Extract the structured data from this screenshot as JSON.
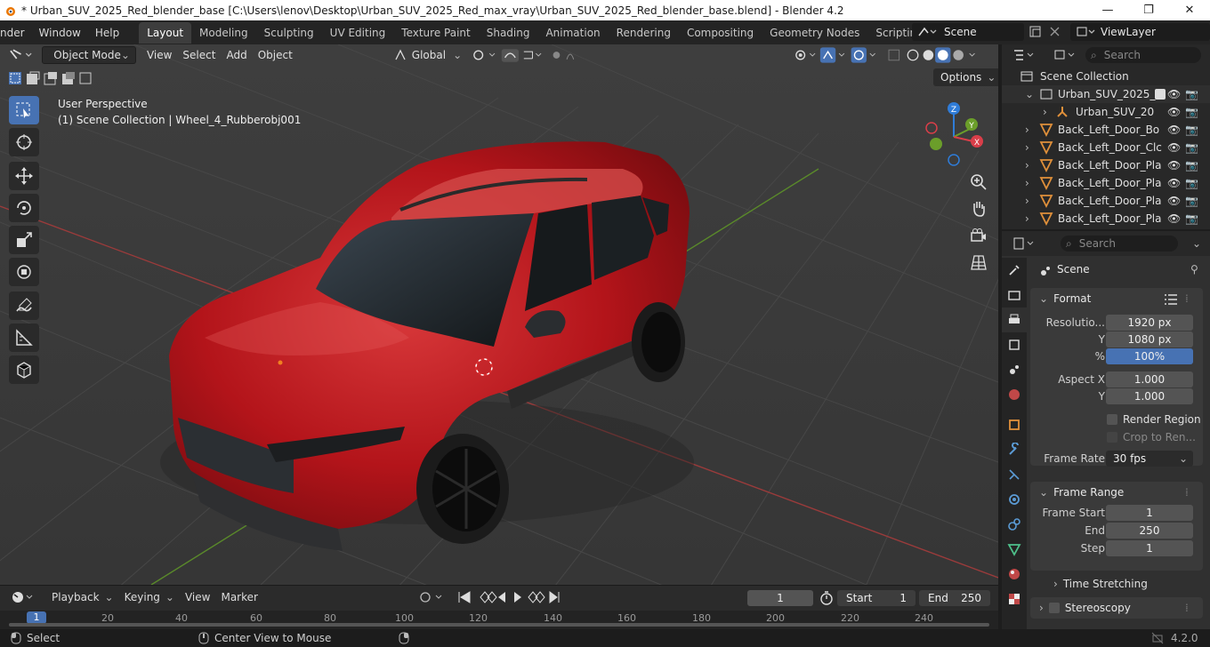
{
  "window": {
    "title": "* Urban_SUV_2025_Red_blender_base [C:\\Users\\lenov\\Desktop\\Urban_SUV_2025_Red_max_vray\\Urban_SUV_2025_Red_blender_base.blend] - Blender 4.2",
    "minimize": "—",
    "maximize": "❐",
    "close": "✕"
  },
  "menu": {
    "items": [
      "nder",
      "Window",
      "Help"
    ]
  },
  "workspaces": {
    "tabs": [
      "Layout",
      "Modeling",
      "Sculpting",
      "UV Editing",
      "Texture Paint",
      "Shading",
      "Animation",
      "Rendering",
      "Compositing",
      "Geometry Nodes",
      "Scripting"
    ],
    "active": "Layout",
    "add": "+"
  },
  "scene_selector": {
    "label": "Scene"
  },
  "viewlayer_selector": {
    "label": "ViewLayer"
  },
  "viewport": {
    "mode": "Object Mode",
    "menus": [
      "View",
      "Select",
      "Add",
      "Object"
    ],
    "transform_orientation": "Global",
    "info_line1": "User Perspective",
    "info_line2": "(1) Scene Collection | Wheel_4_Rubberobj001",
    "options": "Options",
    "gizmo_labels": {
      "z": "Z",
      "y": "Y",
      "x": "X"
    }
  },
  "timeline": {
    "menus": [
      "Playback",
      "Keying",
      "View",
      "Marker"
    ],
    "current_frame": "1",
    "start_label": "Start",
    "start_value": "1",
    "end_label": "End",
    "end_value": "250",
    "ruler_ticks": [
      "20",
      "40",
      "60",
      "80",
      "100",
      "120",
      "140",
      "160",
      "180",
      "200",
      "220",
      "240"
    ],
    "cursor_label": "1"
  },
  "statusbar": {
    "select": "Select",
    "center_view": "Center View to Mouse",
    "version": "4.2.0"
  },
  "outliner": {
    "search_placeholder": "Search",
    "root": "Scene Collection",
    "rows": [
      {
        "name": "Urban_SUV_2025_R",
        "type": "collection"
      },
      {
        "name": "Urban_SUV_20",
        "type": "armature"
      },
      {
        "name": "Back_Left_Door_Bo",
        "type": "mesh"
      },
      {
        "name": "Back_Left_Door_Clc",
        "type": "mesh"
      },
      {
        "name": "Back_Left_Door_Pla",
        "type": "mesh"
      },
      {
        "name": "Back_Left_Door_Pla",
        "type": "mesh"
      },
      {
        "name": "Back_Left_Door_Pla",
        "type": "mesh"
      },
      {
        "name": "Back_Left_Door_Pla",
        "type": "mesh"
      }
    ]
  },
  "properties": {
    "search_placeholder": "Search",
    "context": "Scene",
    "format": {
      "title": "Format",
      "resolution_x_label": "Resolutio...",
      "resolution_x": "1920 px",
      "resolution_y_label": "Y",
      "resolution_y": "1080 px",
      "percent_label": "%",
      "percent": "100%",
      "aspect_x_label": "Aspect X",
      "aspect_x": "1.000",
      "aspect_y_label": "Y",
      "aspect_y": "1.000",
      "render_region": "Render Region",
      "crop": "Crop to Ren...",
      "frame_rate_label": "Frame Rate",
      "frame_rate": "30 fps"
    },
    "frame_range": {
      "title": "Frame Range",
      "start_label": "Frame Start",
      "start": "1",
      "end_label": "End",
      "end": "250",
      "step_label": "Step",
      "step": "1"
    },
    "time_stretching": "Time Stretching",
    "stereoscopy": "Stereoscopy"
  },
  "colors": {
    "accent": "#4772b3",
    "car_red": "#c0161b",
    "grid_red": "#9a3b3b",
    "grid_green": "#5a8a2a"
  }
}
